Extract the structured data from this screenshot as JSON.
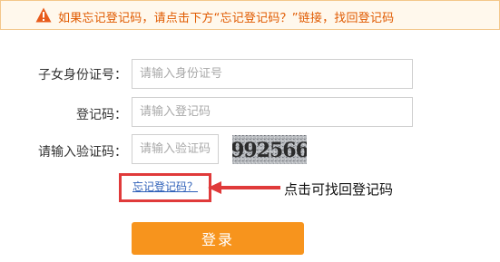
{
  "notice": {
    "icon": "warning-icon",
    "text": "如果忘记登记码，请点击下方“忘记登记码？”链接，找回登记码"
  },
  "form": {
    "id_label": "子女身份证号：",
    "id_placeholder": "请输入身份证号",
    "code_label": "登记码：",
    "code_placeholder": "请输入登记码",
    "captcha_label": "请输入验证码：",
    "captcha_placeholder": "请输入验证码",
    "captcha_image_text": "992566",
    "forgot_link": "忘记登记码？",
    "hint": "点击可找回登记码",
    "submit_label": "登录"
  },
  "colors": {
    "accent": "#f7941d",
    "notice_text": "#e05a00",
    "highlight": "#e03a3a",
    "link": "#2d5fb8"
  }
}
